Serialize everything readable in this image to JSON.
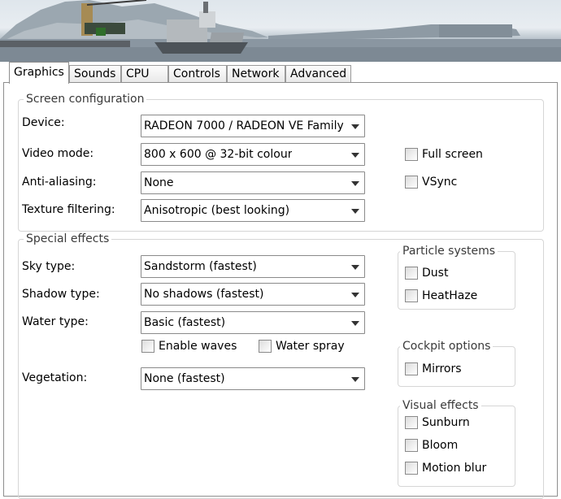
{
  "tabs": [
    "Graphics",
    "Sounds",
    "CPU",
    "Controls",
    "Network",
    "Advanced"
  ],
  "active_tab": "Graphics",
  "screen": {
    "title": "Screen configuration",
    "device_label": "Device:",
    "device_value": "RADEON 7000 / RADEON VE Family (",
    "video_label": "Video mode:",
    "video_value": "800 x 600 @ 32-bit colour",
    "aa_label": "Anti-aliasing:",
    "aa_value": "None",
    "tex_label": "Texture filtering:",
    "tex_value": "Anisotropic (best looking)",
    "fullscreen_label": "Full screen",
    "vsync_label": "VSync"
  },
  "effects": {
    "title": "Special effects",
    "sky_label": "Sky type:",
    "sky_value": "Sandstorm (fastest)",
    "shadow_label": "Shadow type:",
    "shadow_value": "No shadows (fastest)",
    "water_label": "Water type:",
    "water_value": "Basic (fastest)",
    "waves_label": "Enable waves",
    "spray_label": "Water spray",
    "veg_label": "Vegetation:",
    "veg_value": "None (fastest)",
    "particles_title": "Particle systems",
    "dust_label": "Dust",
    "heathaze_label": "HeatHaze",
    "cockpit_title": "Cockpit options",
    "mirrors_label": "Mirrors",
    "visual_title": "Visual effects",
    "sunburn_label": "Sunburn",
    "bloom_label": "Bloom",
    "motionblur_label": "Motion blur"
  },
  "colors": {
    "panel_border": "#8e8e8e",
    "group_border": "#d6d6d6",
    "arrow": "#333333"
  }
}
